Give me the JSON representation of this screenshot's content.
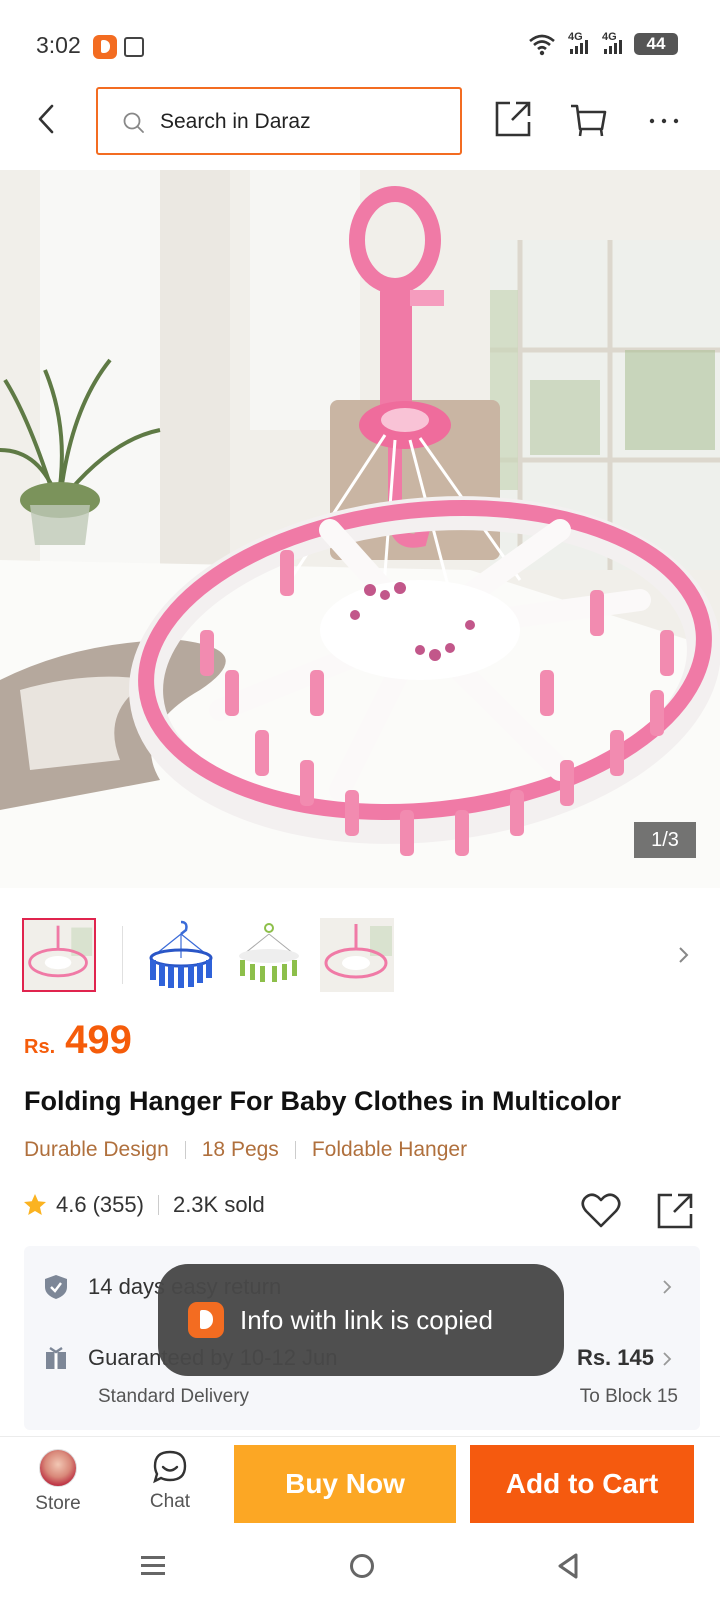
{
  "status_bar": {
    "time": "3:02",
    "network_1": "4G",
    "network_2": "4G",
    "battery": "44"
  },
  "header": {
    "search_placeholder": "Search in Daraz"
  },
  "gallery": {
    "counter": "1/3"
  },
  "product": {
    "currency": "Rs.",
    "price": "499",
    "title": "Folding Hanger For Baby Clothes in Multicolor",
    "tags": [
      "Durable Design",
      "18 Pegs",
      "Foldable Hanger"
    ],
    "rating": "4.6",
    "reviews": "(355)",
    "sold": "2.3K sold"
  },
  "service": {
    "return_text": "14 days easy return",
    "delivery_text": "Guaranteed by 10-12 Jun",
    "delivery_type": "Standard Delivery",
    "delivery_price": "Rs. 145",
    "delivery_location": "To Block 15"
  },
  "toast": {
    "message": "Info with link is copied"
  },
  "bottom_bar": {
    "store_label": "Store",
    "chat_label": "Chat",
    "buy_now": "Buy Now",
    "add_to_cart": "Add to Cart"
  },
  "colors": {
    "accent": "#f36c21",
    "price": "#f55c0a",
    "buy_now": "#fca724",
    "add_to_cart": "#f55a0f",
    "tag_text": "#b0703d",
    "active_thumb_border": "#e0244e"
  },
  "icons": [
    "back-arrow-icon",
    "search-icon",
    "share-icon",
    "cart-icon",
    "more-icon",
    "chevron-right-icon",
    "star-icon",
    "heart-icon",
    "shield-check-icon",
    "gift-box-icon",
    "chat-bubble-icon",
    "menu-lines-icon",
    "home-circle-icon",
    "back-triangle-icon"
  ]
}
